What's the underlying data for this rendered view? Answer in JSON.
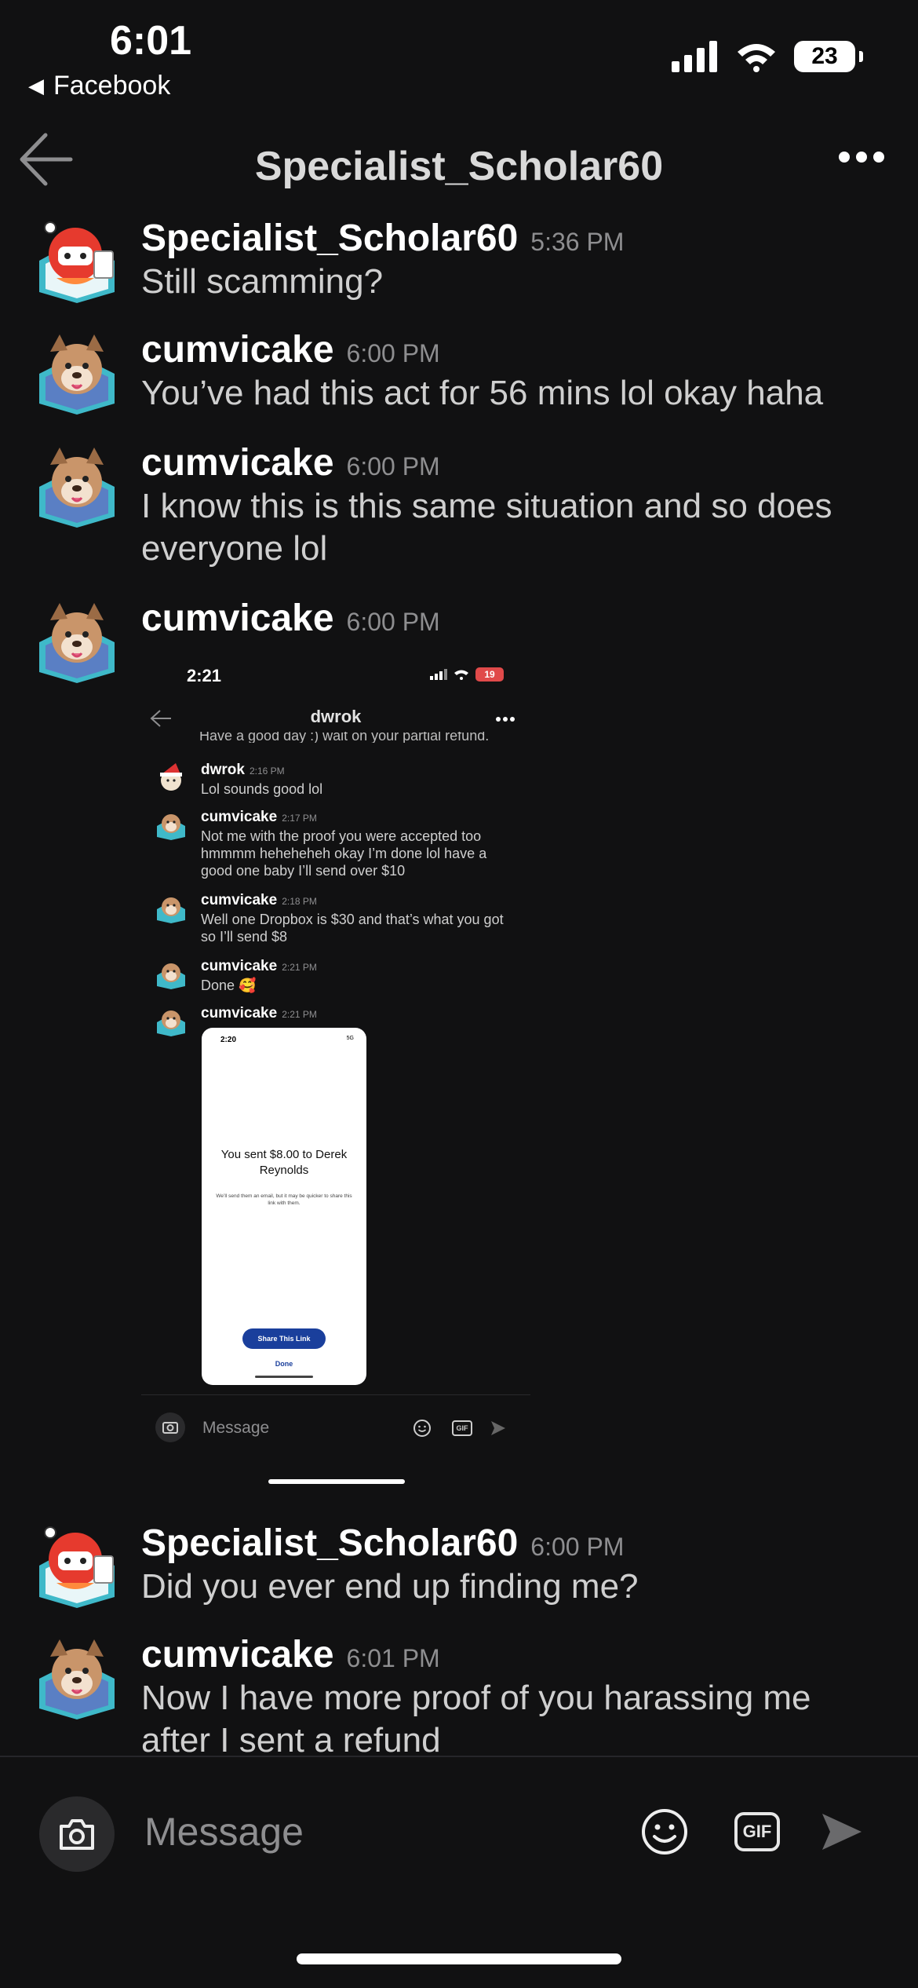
{
  "status_bar": {
    "time": "6:01",
    "back_app": "Facebook",
    "battery": "23"
  },
  "header": {
    "title": "Specialist_Scholar60",
    "back_icon": "arrow-left-icon",
    "more_icon": "more-horizontal-icon"
  },
  "messages": [
    {
      "user": "Specialist_Scholar60",
      "time": "5:36 PM",
      "text": "Still scamming?",
      "avatar": "red-robot-avatar"
    },
    {
      "user": "cumvicake",
      "time": "6:00 PM",
      "text": "You’ve had this act for 56 mins lol okay haha",
      "avatar": "dog-avatar"
    },
    {
      "user": "cumvicake",
      "time": "6:00 PM",
      "text": "I know this is this same situation and so does everyone lol",
      "avatar": "dog-avatar"
    },
    {
      "user": "cumvicake",
      "time": "6:00 PM",
      "text": "",
      "avatar": "dog-avatar"
    },
    {
      "user": "Specialist_Scholar60",
      "time": "6:00 PM",
      "text": "Did you ever end up finding me?",
      "avatar": "red-robot-avatar"
    },
    {
      "user": "cumvicake",
      "time": "6:01 PM",
      "text": "Now I have more proof of you harassing me after I sent a refund",
      "avatar": "dog-avatar"
    }
  ],
  "embedded_screenshot": {
    "time": "2:21",
    "battery": "19",
    "title": "dwrok",
    "cut_text": "Have a good day :) wait on your partial refund.",
    "messages": [
      {
        "user": "dwrok",
        "time": "2:16 PM",
        "text": "Lol sounds good lol"
      },
      {
        "user": "cumvicake",
        "time": "2:17 PM",
        "text": "Not me with the proof you were accepted too hmmmm heheheheh okay I’m done lol have a good one baby I’ll send over $10"
      },
      {
        "user": "cumvicake",
        "time": "2:18 PM",
        "text": "Well one Dropbox is $30 and that’s what you got so I’ll send $8"
      },
      {
        "user": "cumvicake",
        "time": "2:21 PM",
        "text": "Done 🥰"
      },
      {
        "user": "cumvicake",
        "time": "2:21 PM",
        "text": ""
      }
    ],
    "inner_phone": {
      "time": "2:20",
      "status": "5G",
      "title": "You sent $8.00 to Derek Reynolds",
      "subtitle": "We’ll send them an email, but it may be quicker to share this link with them.",
      "share_button": "Share This Link",
      "done_button": "Done"
    },
    "input_placeholder": "Message",
    "gif_label": "GIF"
  },
  "composer": {
    "placeholder": "Message",
    "gif_label": "GIF"
  },
  "colors": {
    "background": "#111112",
    "text": "#cfcfcf",
    "muted": "#8e8e90",
    "accent_blue": "#1a3f9c"
  }
}
